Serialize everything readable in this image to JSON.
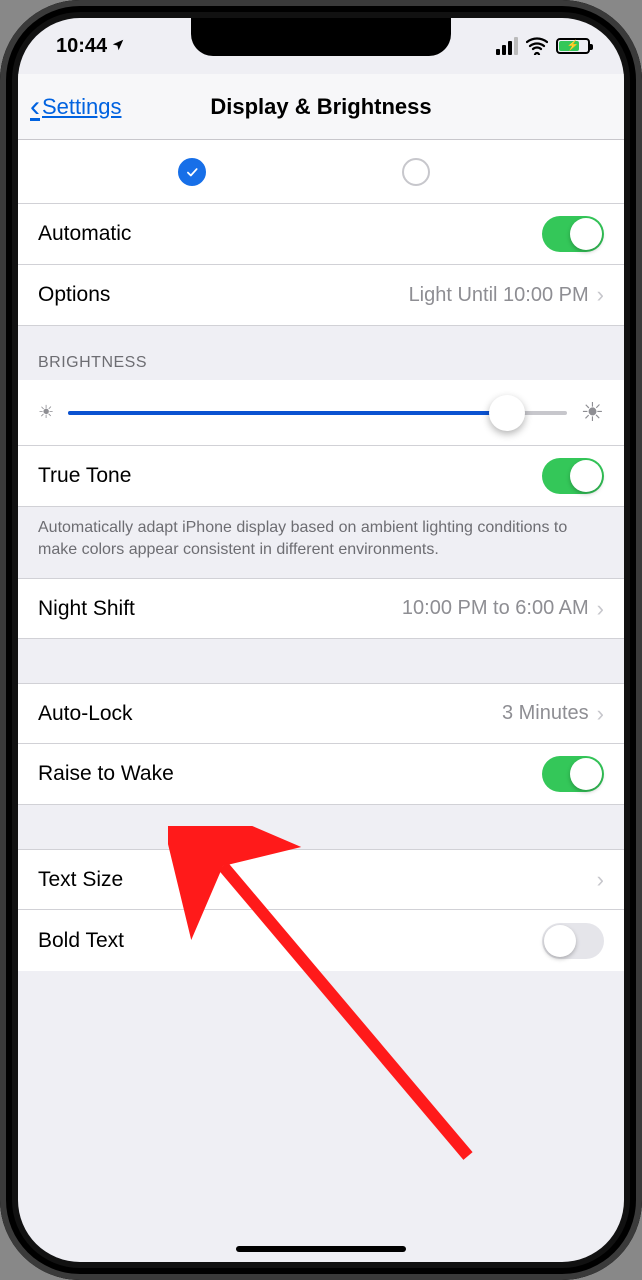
{
  "status": {
    "time": "10:44"
  },
  "nav": {
    "back": "Settings",
    "title": "Display & Brightness"
  },
  "appearance": {
    "automatic_label": "Automatic",
    "automatic_on": true,
    "options_label": "Options",
    "options_value": "Light Until 10:00 PM"
  },
  "brightness": {
    "header": "BRIGHTNESS",
    "slider_percent": 88,
    "true_tone_label": "True Tone",
    "true_tone_on": true,
    "footnote": "Automatically adapt iPhone display based on ambient lighting conditions to make colors appear consistent in different environments."
  },
  "night_shift": {
    "label": "Night Shift",
    "value": "10:00 PM to 6:00 AM"
  },
  "auto_lock": {
    "label": "Auto-Lock",
    "value": "3 Minutes"
  },
  "raise_to_wake": {
    "label": "Raise to Wake",
    "on": true
  },
  "text_size": {
    "label": "Text Size"
  },
  "bold_text": {
    "label": "Bold Text",
    "on": false
  }
}
